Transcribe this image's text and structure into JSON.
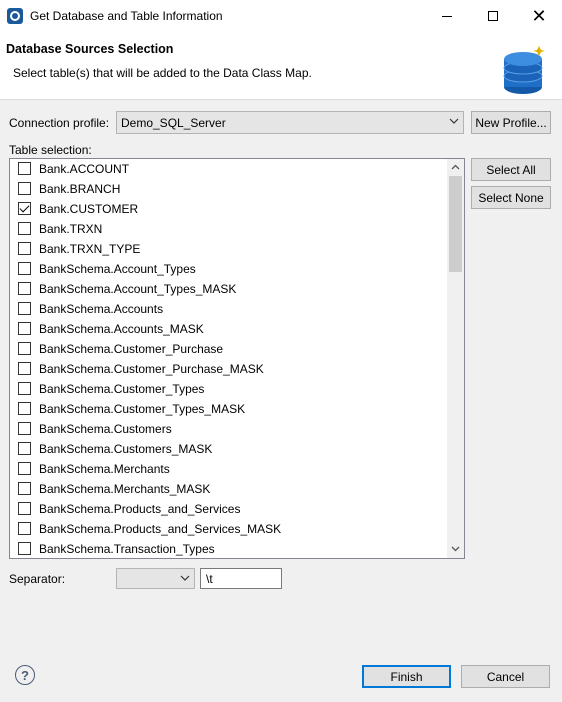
{
  "window": {
    "title": "Get Database and Table Information"
  },
  "header": {
    "title": "Database Sources Selection",
    "subtitle": "Select table(s) that will be added to the Data Class Map."
  },
  "connection": {
    "label": "Connection profile:",
    "value": "Demo_SQL_Server",
    "new_profile_label": "New Profile..."
  },
  "tables": {
    "label": "Table selection:",
    "select_all_label": "Select All",
    "select_none_label": "Select None",
    "items": [
      {
        "name": "Bank.ACCOUNT",
        "checked": false
      },
      {
        "name": "Bank.BRANCH",
        "checked": false
      },
      {
        "name": "Bank.CUSTOMER",
        "checked": true
      },
      {
        "name": "Bank.TRXN",
        "checked": false
      },
      {
        "name": "Bank.TRXN_TYPE",
        "checked": false
      },
      {
        "name": "BankSchema.Account_Types",
        "checked": false
      },
      {
        "name": "BankSchema.Account_Types_MASK",
        "checked": false
      },
      {
        "name": "BankSchema.Accounts",
        "checked": false
      },
      {
        "name": "BankSchema.Accounts_MASK",
        "checked": false
      },
      {
        "name": "BankSchema.Customer_Purchase",
        "checked": false
      },
      {
        "name": "BankSchema.Customer_Purchase_MASK",
        "checked": false
      },
      {
        "name": "BankSchema.Customer_Types",
        "checked": false
      },
      {
        "name": "BankSchema.Customer_Types_MASK",
        "checked": false
      },
      {
        "name": "BankSchema.Customers",
        "checked": false
      },
      {
        "name": "BankSchema.Customers_MASK",
        "checked": false
      },
      {
        "name": "BankSchema.Merchants",
        "checked": false
      },
      {
        "name": "BankSchema.Merchants_MASK",
        "checked": false
      },
      {
        "name": "BankSchema.Products_and_Services",
        "checked": false
      },
      {
        "name": "BankSchema.Products_and_Services_MASK",
        "checked": false
      },
      {
        "name": "BankSchema.Transaction_Types",
        "checked": false
      }
    ]
  },
  "separator": {
    "label": "Separator:",
    "combo_value": "",
    "value": "\\t"
  },
  "footer": {
    "finish_label": "Finish",
    "cancel_label": "Cancel"
  },
  "icons": {
    "app": "app-icon",
    "database": "database-icon",
    "help": "help-icon",
    "help_glyph": "?"
  },
  "colors": {
    "accent": "#0078d7",
    "db_blue": "#1e6fc8",
    "help": "#4a5d78"
  }
}
